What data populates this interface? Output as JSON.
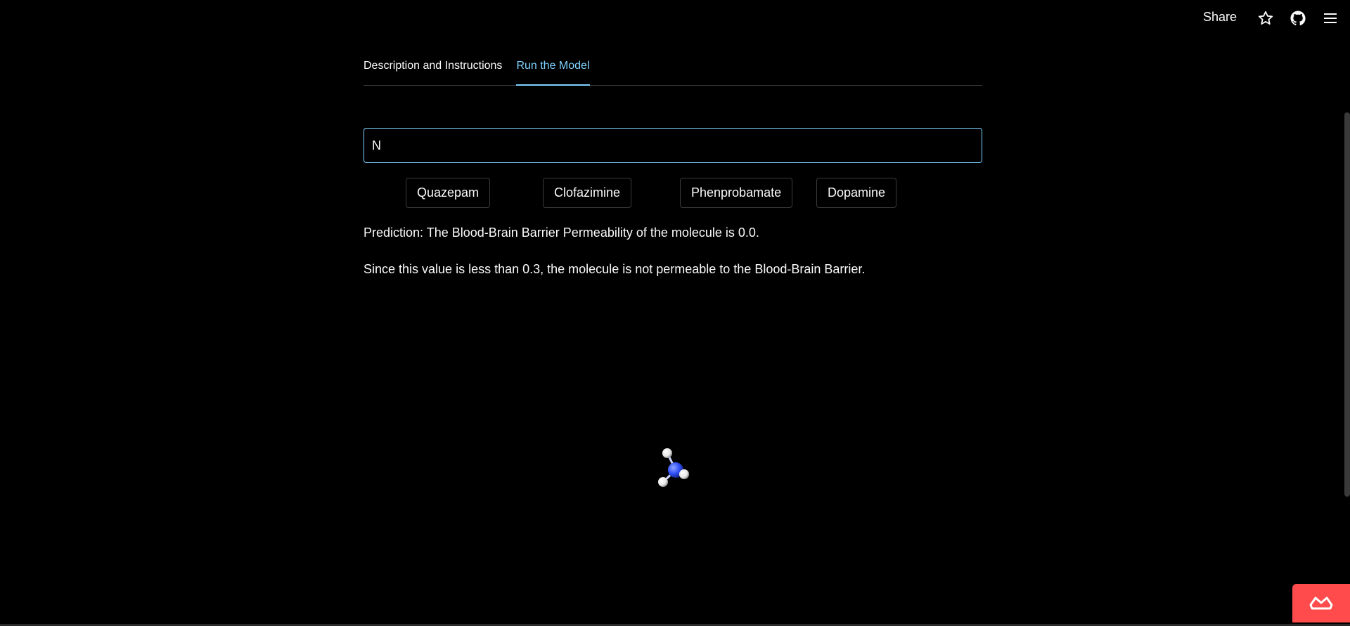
{
  "header": {
    "share_label": "Share",
    "icons": [
      "star-icon",
      "github-icon",
      "hamburger-menu-icon"
    ]
  },
  "tabs": [
    {
      "label": "Description and Instructions",
      "active": false
    },
    {
      "label": "Run the Model",
      "active": true
    }
  ],
  "input": {
    "value": "N"
  },
  "examples": [
    {
      "label": "Quazepam"
    },
    {
      "label": "Clofazimine"
    },
    {
      "label": "Phenprobamate"
    },
    {
      "label": "Dopamine"
    }
  ],
  "results": {
    "prediction": "Prediction: The Blood-Brain Barrier Permeability of the molecule is 0.0.",
    "explanation": "Since this value is less than 0.3, the molecule is not permeable to the Blood-Brain Barrier."
  },
  "colors": {
    "background": "#000000",
    "accent": "#7fd2ff",
    "badge": "#ff4b4b",
    "nitrogen_atom": "#3050f8",
    "hydrogen_atom": "#ffffff"
  },
  "badge_icon": "crown-icon"
}
